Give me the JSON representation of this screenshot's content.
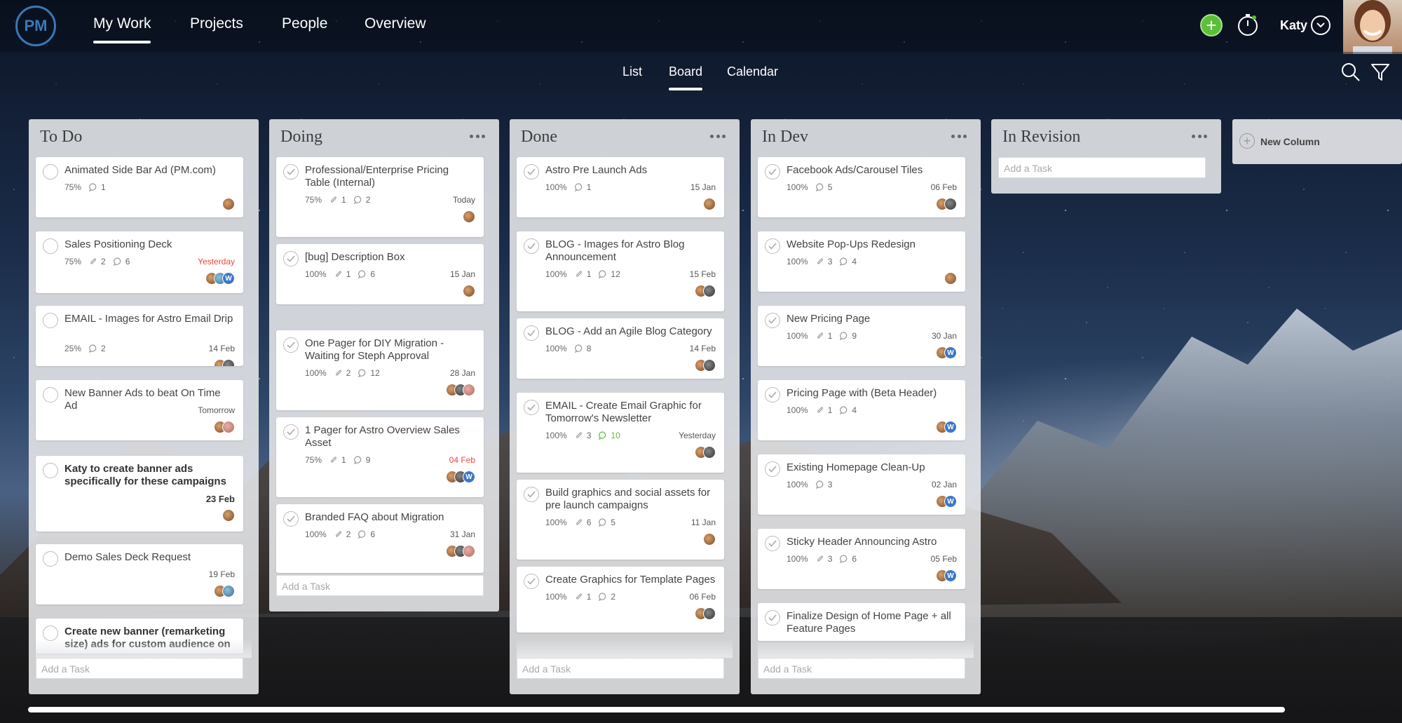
{
  "colors": {
    "accent_green": "#5bbf3a",
    "due_overdue": "#e84a3b",
    "logo_blue": "#3a78b8"
  },
  "topnav": {
    "logo": "PM",
    "items": [
      "My Work",
      "Projects",
      "People",
      "Overview"
    ],
    "active": "My Work",
    "user": "Katy"
  },
  "views": {
    "tabs": [
      "List",
      "Board",
      "Calendar"
    ],
    "active": "Board"
  },
  "add_task_placeholder": "Add a Task",
  "new_column_label": "New Column",
  "columns": [
    {
      "title": "To Do",
      "cards": [
        {
          "title": "Animated Side Bar Ad (PM.com)",
          "progress": "75%",
          "comments": "1",
          "due": "",
          "avatars": [
            "a1"
          ]
        },
        {
          "title": "Sales Positioning Deck",
          "progress": "75%",
          "attachments": "2",
          "comments": "6",
          "due": "Yesterday",
          "due_style": "red",
          "avatars": [
            "a1",
            "a5",
            "a4"
          ]
        },
        {
          "title": "EMAIL - Images for Astro Email Drip",
          "progress": "25%",
          "comments": "2",
          "due": "14 Feb",
          "avatars": [
            "a1",
            "a2"
          ]
        },
        {
          "title": "New Banner Ads to beat On Time Ad",
          "due": "Tomorrow",
          "avatars": [
            "a1",
            "a3"
          ]
        },
        {
          "title": "Katy to create banner ads specifically for these campaigns",
          "bold": true,
          "due": "23 Feb",
          "due_style": "bold",
          "avatars": [
            "a1"
          ]
        },
        {
          "title": "Demo Sales Deck Request",
          "due": "19 Feb",
          "avatars": [
            "a1",
            "a5"
          ]
        },
        {
          "title": "Create new banner (remarketing size) ads for custom audience on",
          "bold": true
        }
      ]
    },
    {
      "title": "Doing",
      "cards": [
        {
          "title": "Professional/Enterprise Pricing Table (Internal)",
          "progress": "75%",
          "attachments": "1",
          "comments": "2",
          "due": "Today",
          "avatars": [
            "a1"
          ]
        },
        {
          "title": "[bug] Description Box",
          "progress": "100%",
          "attachments": "1",
          "comments": "6",
          "due": "15 Jan",
          "avatars": [
            "a1"
          ]
        },
        {
          "title": "One Pager for DIY Migration - Waiting for Steph Approval",
          "progress": "100%",
          "attachments": "2",
          "comments": "12",
          "due": "28 Jan",
          "avatars": [
            "a1",
            "a2",
            "a3"
          ]
        },
        {
          "title": "1 Pager for Astro Overview Sales Asset",
          "progress": "75%",
          "attachments": "1",
          "comments": "9",
          "due": "04 Feb",
          "due_style": "red",
          "avatars": [
            "a1",
            "a2",
            "a4"
          ]
        },
        {
          "title": "Branded FAQ about Migration",
          "progress": "100%",
          "attachments": "2",
          "comments": "6",
          "due": "31 Jan",
          "avatars": [
            "a1",
            "a2",
            "a3"
          ]
        }
      ]
    },
    {
      "title": "Done",
      "cards": [
        {
          "title": "Astro Pre Launch Ads",
          "progress": "100%",
          "comments": "1",
          "due": "15 Jan",
          "avatars": [
            "a1"
          ]
        },
        {
          "title": "BLOG - Images for Astro Blog Announcement",
          "progress": "100%",
          "attachments": "1",
          "comments": "12",
          "due": "15 Feb",
          "avatars": [
            "a1",
            "a2"
          ]
        },
        {
          "title": "BLOG - Add an Agile Blog Category",
          "progress": "100%",
          "comments": "8",
          "due": "14 Feb",
          "avatars": [
            "a1",
            "a2"
          ]
        },
        {
          "title": "EMAIL - Create Email Graphic for Tomorrow's Newsletter",
          "progress": "100%",
          "attachments": "3",
          "comments": "10",
          "comments_green": true,
          "due": "Yesterday",
          "avatars": [
            "a1",
            "a2"
          ]
        },
        {
          "title": "Build graphics and social assets for pre launch campaigns",
          "progress": "100%",
          "attachments": "6",
          "comments": "5",
          "due": "11 Jan",
          "avatars": [
            "a1"
          ]
        },
        {
          "title": "Create Graphics for Template Pages",
          "progress": "100%",
          "attachments": "1",
          "comments": "2",
          "due": "06 Feb",
          "avatars": [
            "a1",
            "a2"
          ]
        }
      ]
    },
    {
      "title": "In Dev",
      "cards": [
        {
          "title": "Facebook Ads/Carousel Tiles",
          "progress": "100%",
          "comments": "5",
          "due": "06 Feb",
          "avatars": [
            "a1",
            "a2"
          ]
        },
        {
          "title": "Website Pop-Ups Redesign",
          "progress": "100%",
          "attachments": "3",
          "comments": "4",
          "due": "",
          "avatars": [
            "a1"
          ]
        },
        {
          "title": "New Pricing Page",
          "progress": "100%",
          "attachments": "1",
          "comments": "9",
          "due": "30 Jan",
          "avatars": [
            "a1",
            "a4"
          ]
        },
        {
          "title": "Pricing Page with (Beta Header)",
          "progress": "100%",
          "attachments": "1",
          "comments": "4",
          "due": "",
          "avatars": [
            "a1",
            "a4"
          ]
        },
        {
          "title": "Existing Homepage Clean-Up",
          "progress": "100%",
          "comments": "3",
          "due": "02 Jan",
          "avatars": [
            "a1",
            "a4"
          ]
        },
        {
          "title": "Sticky Header Announcing Astro",
          "progress": "100%",
          "attachments": "3",
          "comments": "6",
          "due": "05 Feb",
          "avatars": [
            "a1",
            "a4"
          ]
        },
        {
          "title": "Finalize Design of Home Page + all Feature Pages"
        }
      ]
    },
    {
      "title": "In Revision",
      "cards": []
    }
  ]
}
